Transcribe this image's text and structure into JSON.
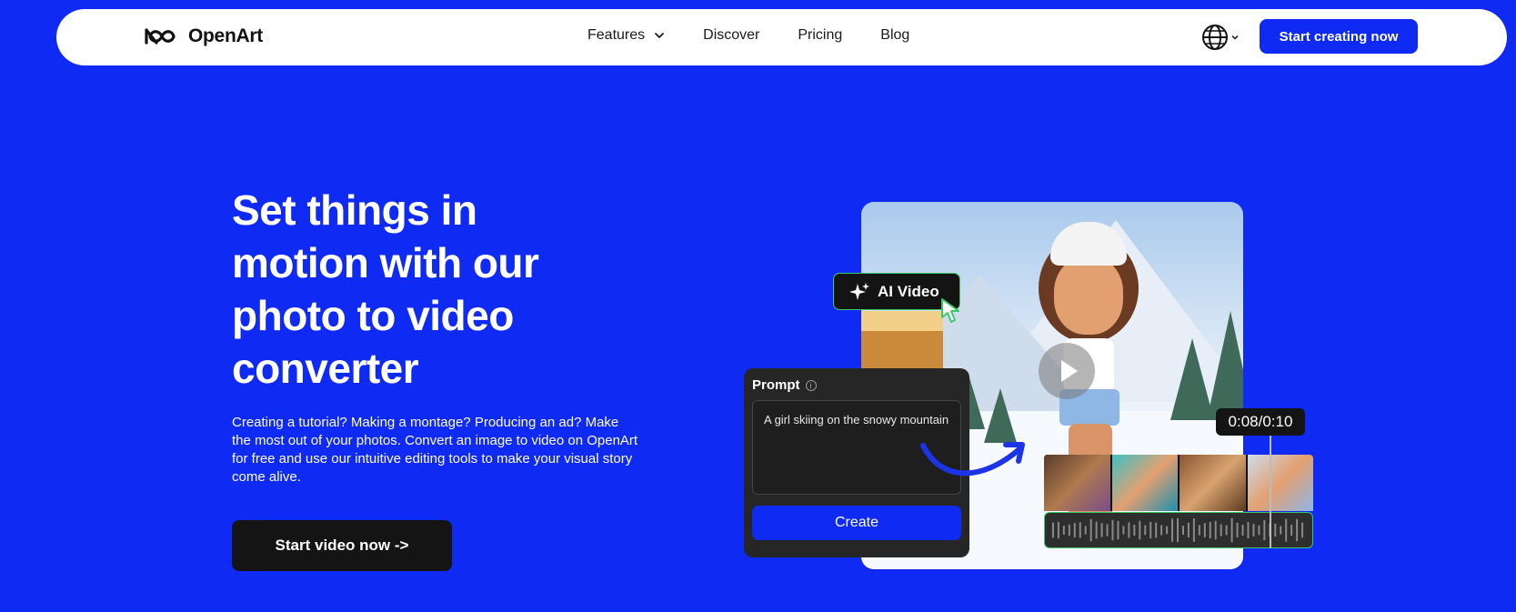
{
  "nav": {
    "logo_text": "OpenArt",
    "items": [
      {
        "label": "Features",
        "has_dropdown": true
      },
      {
        "label": "Discover"
      },
      {
        "label": "Pricing"
      },
      {
        "label": "Blog"
      }
    ],
    "language_icon": "globe-icon",
    "cta_label": "Start creating now"
  },
  "hero": {
    "title": "Set things in motion with our photo to video converter",
    "description": "Creating a tutorial? Making a montage? Producing an ad? Make the most out of your photos. Convert an image to video on OpenArt for free and use our intuitive editing tools to make your visual story come alive.",
    "cta_label": "Start video now ->"
  },
  "visual": {
    "ai_badge_label": "AI Video",
    "prompt_label": "Prompt",
    "prompt_text": "A girl skiing on the snowy mountain",
    "create_label": "Create",
    "timecode": "0:08/0:10"
  },
  "colors": {
    "background": "#0e2af3",
    "accent": "#0e2af3",
    "dark": "#141414",
    "green_outline": "#3ec86a"
  }
}
